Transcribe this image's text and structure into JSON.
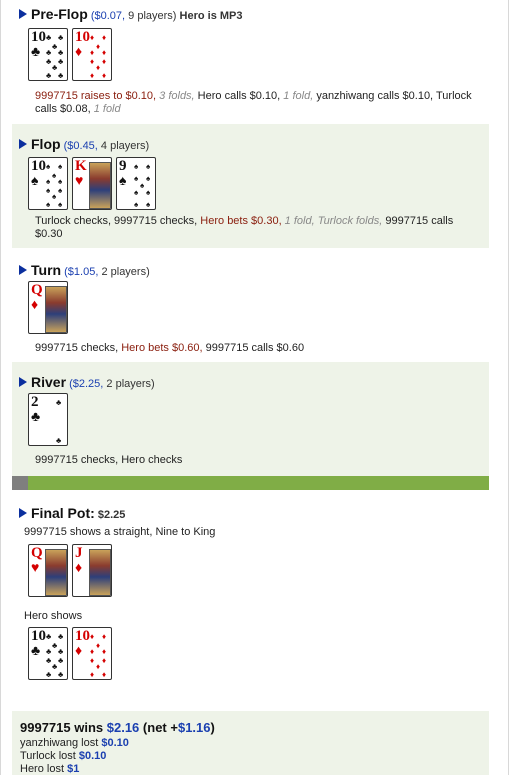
{
  "preflop": {
    "title": "Pre-Flop",
    "pot": "($0.07,",
    "players": "9 players)",
    "hero": "Hero is MP3",
    "cards": [
      {
        "rank": "10",
        "suit": "♣",
        "color": "black"
      },
      {
        "rank": "10",
        "suit": "♦",
        "color": "red"
      }
    ],
    "actions": [
      {
        "text": "9997715 raises to $0.10,",
        "style": "red"
      },
      {
        "text": " 3 folds,",
        "style": "ital"
      },
      {
        "text": " Hero calls $0.10,",
        "style": "plain"
      },
      {
        "text": " 1 fold,",
        "style": "ital"
      },
      {
        "text": " yanzhiwang calls $0.10, Turlock calls $0.08,",
        "style": "plain"
      },
      {
        "text": " 1 fold",
        "style": "ital"
      }
    ]
  },
  "flop": {
    "title": "Flop",
    "pot": "($0.45,",
    "players": "4 players)",
    "cards": [
      {
        "rank": "10",
        "suit": "♠",
        "color": "black"
      },
      {
        "rank": "K",
        "suit": "♥",
        "color": "red",
        "face": true
      },
      {
        "rank": "9",
        "suit": "♠",
        "color": "black"
      }
    ],
    "actions": [
      {
        "text": "Turlock checks, 9997715 checks,",
        "style": "plain"
      },
      {
        "text": " Hero bets $0.30,",
        "style": "red"
      },
      {
        "text": " 1 fold, Turlock folds,",
        "style": "ital"
      },
      {
        "text": " 9997715 calls $0.30",
        "style": "plain"
      }
    ]
  },
  "turn": {
    "title": "Turn",
    "pot": "($1.05,",
    "players": "2 players)",
    "cards": [
      {
        "rank": "Q",
        "suit": "♦",
        "color": "red",
        "face": true
      }
    ],
    "actions": [
      {
        "text": "9997715 checks,",
        "style": "plain"
      },
      {
        "text": " Hero bets $0.60,",
        "style": "red"
      },
      {
        "text": " 9997715 calls $0.60",
        "style": "plain"
      }
    ]
  },
  "river": {
    "title": "River",
    "pot": "($2.25,",
    "players": "2 players)",
    "cards": [
      {
        "rank": "2",
        "suit": "♣",
        "color": "black"
      }
    ],
    "actions": [
      {
        "text": "9997715 checks, Hero checks",
        "style": "plain"
      }
    ]
  },
  "final": {
    "title": "Final Pot:",
    "pot": "$2.25",
    "shows1": "9997715 shows a straight, Nine to King",
    "cards1": [
      {
        "rank": "Q",
        "suit": "♥",
        "color": "red",
        "face": true
      },
      {
        "rank": "J",
        "suit": "♦",
        "color": "red",
        "face": true
      }
    ],
    "shows2": "Hero shows",
    "cards2": [
      {
        "rank": "10",
        "suit": "♣",
        "color": "black"
      },
      {
        "rank": "10",
        "suit": "♦",
        "color": "red"
      }
    ]
  },
  "result": {
    "winner": "9997715 wins",
    "amount": "$2.16",
    "net_open": "(net +",
    "net": "$1.16",
    "net_close": ")",
    "losses": [
      {
        "name": "yanzhiwang lost",
        "amount": "$0.10"
      },
      {
        "name": "Turlock lost",
        "amount": "$0.10"
      },
      {
        "name": "Hero lost",
        "amount": "$1"
      }
    ]
  }
}
